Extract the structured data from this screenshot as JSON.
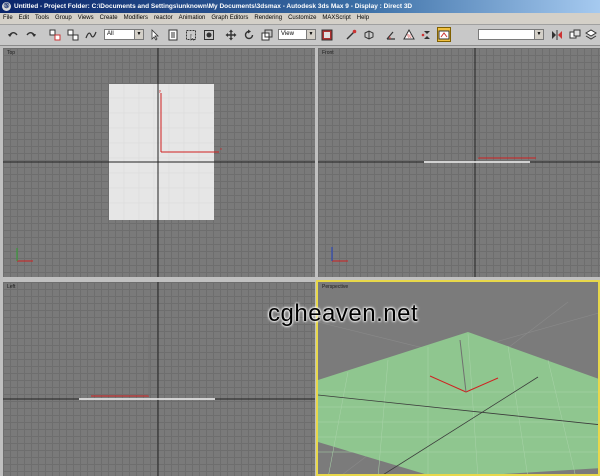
{
  "window": {
    "title": "Untitled    - Project Folder: C:\\Documents and Settings\\unknown\\My Documents\\3dsmax    - Autodesk 3ds Max 9    - Display : Direct 3D"
  },
  "menu": [
    "File",
    "Edit",
    "Tools",
    "Group",
    "Views",
    "Create",
    "Modifiers",
    "reactor",
    "Animation",
    "Graph Editors",
    "Rendering",
    "Customize",
    "MAXScript",
    "Help"
  ],
  "toolbar": {
    "selection_filter": "All",
    "reference_coord": "View",
    "named_selection": "",
    "icons": [
      "undo-icon",
      "redo-icon",
      "link-icon",
      "unlink-icon",
      "bind-space-warp-icon",
      "select-object-icon",
      "select-by-name-icon",
      "rect-select-region-icon",
      "window-crossing-icon",
      "move-icon",
      "rotate-icon",
      "scale-icon",
      "pivot-center-icon",
      "select-manipulate-icon",
      "snap-icon",
      "angle-snap-icon",
      "percent-snap-icon",
      "spinner-snap-icon",
      "edit-named-selection-icon",
      "mirror-icon",
      "align-icon",
      "layer-manager-icon",
      "curve-editor-icon",
      "schematic-view-icon",
      "material-editor-icon",
      "render-scene-icon",
      "quick-render-icon"
    ]
  },
  "viewports": {
    "top": {
      "label": "Top"
    },
    "front": {
      "label": "Front"
    },
    "left": {
      "label": "Left"
    },
    "perspective": {
      "label": "Perspective"
    }
  },
  "watermark": "cgheaven.net",
  "colors": {
    "plane_white": "#e6e6e6",
    "plane_green": "#8fc68f",
    "active_border": "#e8d84a",
    "gizmo_red": "#d02020"
  }
}
